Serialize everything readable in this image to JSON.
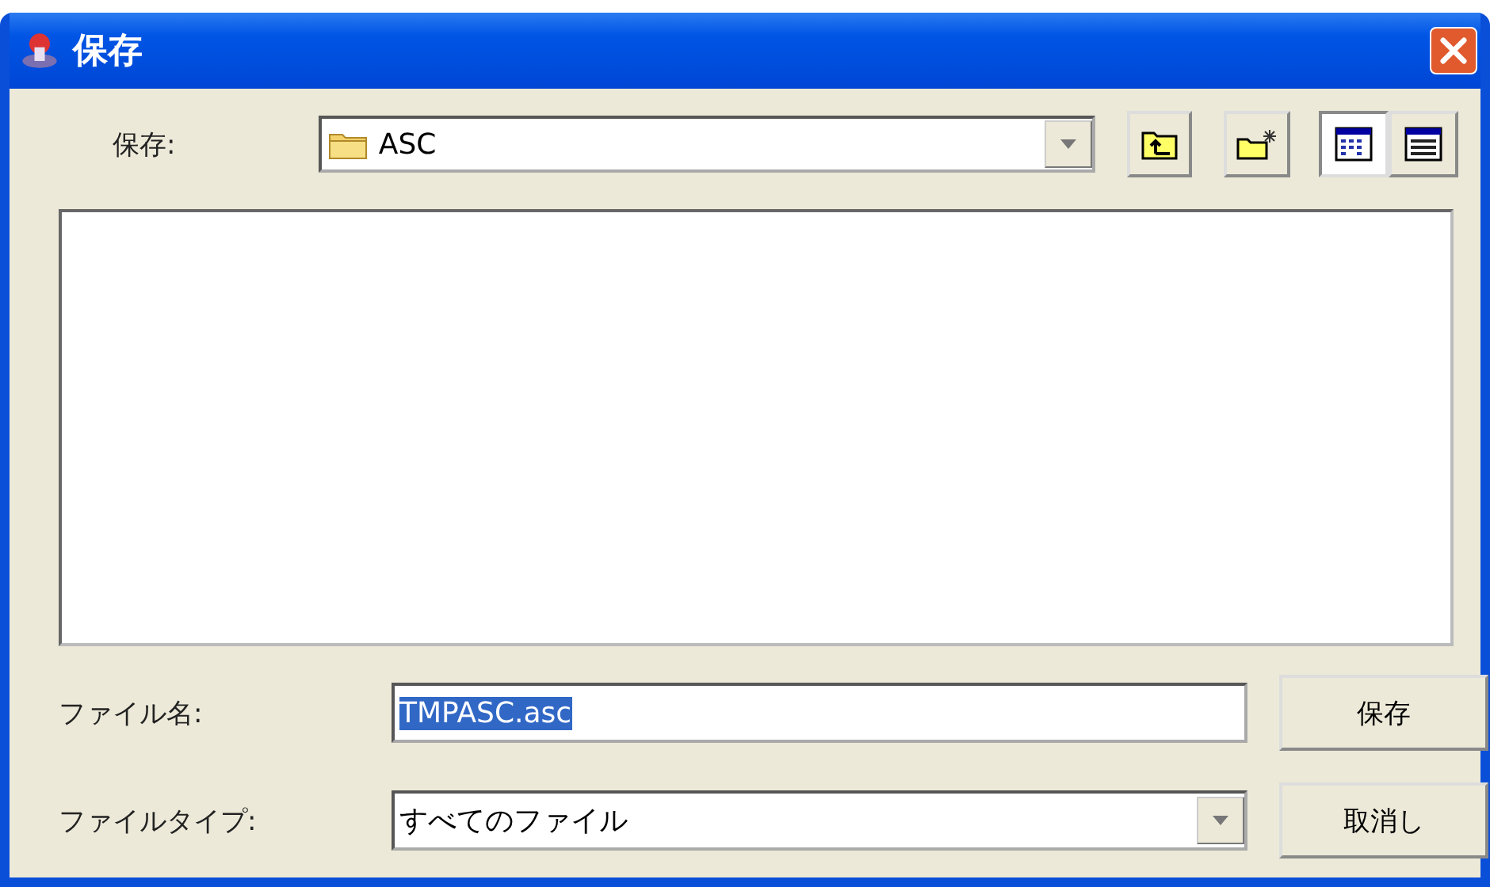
{
  "window": {
    "title": "保存"
  },
  "look_in": {
    "label": "保存:",
    "value": "ASC"
  },
  "view_buttons": [
    {
      "kind": "list",
      "selected": true
    },
    {
      "kind": "details",
      "selected": false
    }
  ],
  "file_name": {
    "label": "ファイル名:",
    "value": "TMPASC.asc"
  },
  "file_type": {
    "label": "ファイルタイプ:",
    "value": "すべてのファイル"
  },
  "buttons": [
    "保存",
    "取消し"
  ]
}
